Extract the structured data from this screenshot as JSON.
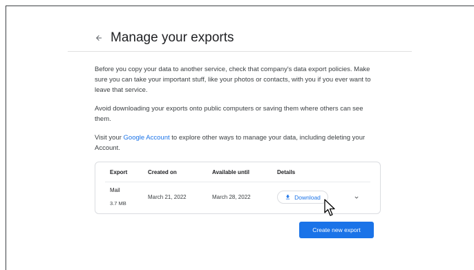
{
  "header": {
    "back_icon": "arrow-back-icon",
    "title": "Manage your exports"
  },
  "intro": {
    "p1": "Before you copy your data to another service, check that company's data export policies. Make sure you can take your important stuff, like your photos or contacts, with you if you ever want to leave that service.",
    "p2": "Avoid downloading your exports onto public computers or saving them where others can see them.",
    "p3_before": "Visit your ",
    "p3_link": "Google Account",
    "p3_after": " to explore other ways to manage your data, including deleting your Account."
  },
  "table": {
    "headers": [
      "Export",
      "Created on",
      "Available until",
      "Details"
    ],
    "rows": [
      {
        "export_name": "Mail",
        "size": "3.7 MB",
        "created_on": "March 21, 2022",
        "available_until": "March 28, 2022",
        "download_label": "Download"
      }
    ]
  },
  "actions": {
    "create_label": "Create new export"
  },
  "colors": {
    "accent": "#1a73e8",
    "text": "#3c4043",
    "border": "#dadce0"
  }
}
